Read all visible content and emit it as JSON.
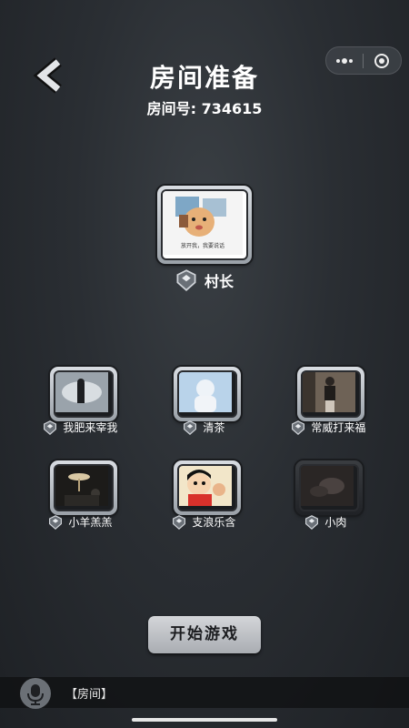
{
  "header": {
    "title": "房间准备",
    "room_label": "房间号: 734615"
  },
  "host": {
    "name": "村长",
    "avatar_caption": "放开我，我要说话"
  },
  "players": [
    {
      "name": "我肥来宰我"
    },
    {
      "name": "清茶"
    },
    {
      "name": "常威打来福"
    },
    {
      "name": "小羊羔羔"
    },
    {
      "name": "支浪乐含"
    },
    {
      "name": "小肉"
    }
  ],
  "actions": {
    "start_label": "开始游戏"
  },
  "chat": {
    "message": "【房间】"
  },
  "colors": {
    "background": "#2a2e33",
    "frame": "#c9cdd2",
    "button": "#c4c7cb"
  }
}
